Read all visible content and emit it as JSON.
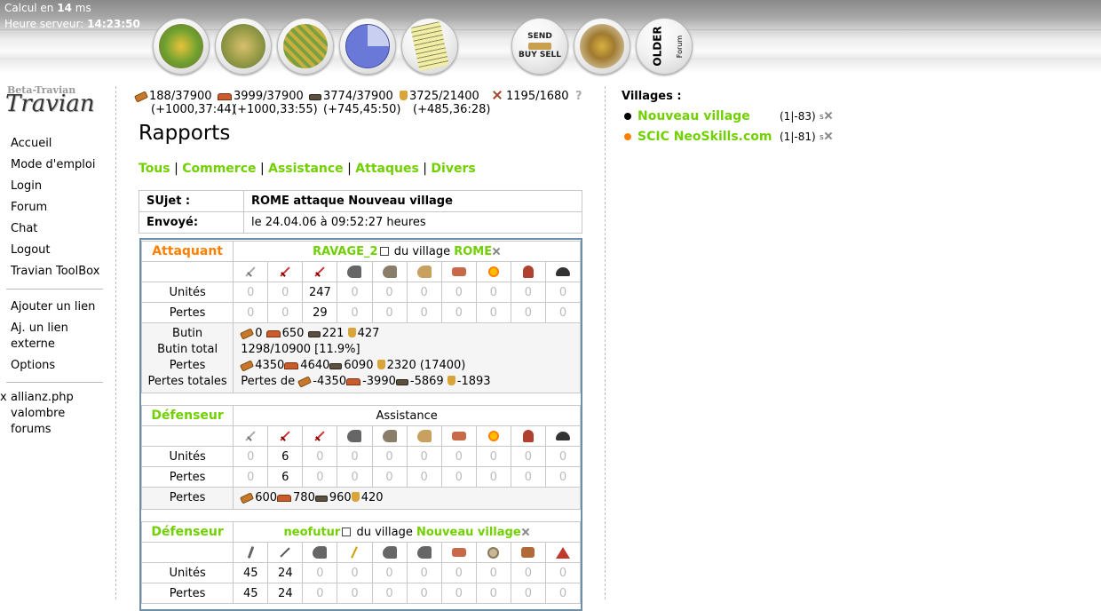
{
  "topbar": {
    "calc_prefix": "Calcul en ",
    "calc_value": "14",
    "calc_suffix": " ms",
    "heure_label": "Heure serveur: ",
    "heure_value": "14:23:50",
    "nav_buttons": [
      {
        "name": "village-overview",
        "icon": "village-fields-icon"
      },
      {
        "name": "village-center",
        "icon": "village-center-icon"
      },
      {
        "name": "map",
        "icon": "map-icon"
      },
      {
        "name": "statistics",
        "icon": "statistics-pie-icon"
      },
      {
        "name": "reports",
        "icon": "reports-icon"
      },
      {
        "name": "marketplace",
        "icon": "send-buy-sell-icon",
        "label_top": "SEND",
        "label_bottom": "BUY SELL"
      },
      {
        "name": "rally-point",
        "icon": "rally-point-icon"
      },
      {
        "name": "forum",
        "icon": "older-forum-icon",
        "label": "OLDER",
        "label2": "Forum"
      }
    ]
  },
  "logo": {
    "top": "Beta-Travian",
    "main": "Travian"
  },
  "menu": {
    "main": [
      "Accueil",
      "Mode d'emploi",
      "Login",
      "Forum",
      "Chat",
      "Logout",
      "Travian ToolBox"
    ],
    "links": [
      "Ajouter un lien",
      "Aj. un lien externe",
      "Options"
    ],
    "extra": [
      {
        "x": "x",
        "label": "allianz.php"
      },
      {
        "x": "x",
        "label": "valombre forums"
      }
    ]
  },
  "resources": {
    "wood": {
      "value": "188/37900",
      "prod": "(+1000,37:44)",
      "icon": "wood-icon"
    },
    "clay": {
      "value": "3999/37900",
      "prod": "(+1000,33:55)",
      "icon": "clay-icon"
    },
    "iron": {
      "value": "3774/37900",
      "prod": "(+745,45:50)",
      "icon": "iron-icon"
    },
    "crop": {
      "value": "3725/21400",
      "prod": "(+485,36:28)",
      "icon": "crop-icon"
    },
    "consumption": {
      "value": "1195/1680",
      "icon": "crop-consumption-icon"
    },
    "help": "?"
  },
  "page": {
    "title": "Rapports"
  },
  "filters": [
    "Tous",
    "Commerce",
    "Assistance",
    "Attaques",
    "Divers"
  ],
  "report": {
    "subject_label": "SUjet :",
    "subject_value": "ROME attaque Nouveau village",
    "sent_label": "Envoyé:",
    "sent_value": "le 24.04.06 à 09:52:27 heures"
  },
  "attacker": {
    "role": "Attaquant",
    "player": "RAVAGE_2",
    "mid": " du village ",
    "village": "ROME",
    "units_label": "Unités",
    "losses_label": "Pertes",
    "units": [
      "0",
      "0",
      "247",
      "0",
      "0",
      "0",
      "0",
      "0",
      "0",
      "0"
    ],
    "losses": [
      "0",
      "0",
      "29",
      "0",
      "0",
      "0",
      "0",
      "0",
      "0",
      "0"
    ],
    "butin_label": "Butin",
    "butin": [
      "0",
      "650",
      "221",
      "427"
    ],
    "butin_total_label": "Butin total",
    "butin_total": "1298/10900 [11.9%]",
    "pertes_label": "Pertes",
    "pertes": [
      "4350",
      "4640",
      "6090",
      "2320"
    ],
    "pertes_sum": " (17400)",
    "pertes_totales_label": "Pertes totales",
    "pertes_totales_prefix": "Pertes de ",
    "pertes_totales": [
      "-4350",
      "-3990",
      "-5869",
      "-1893"
    ]
  },
  "defender1": {
    "role": "Défenseur",
    "subtitle": "Assistance",
    "units_label": "Unités",
    "losses_label": "Pertes",
    "units": [
      "0",
      "6",
      "0",
      "0",
      "0",
      "0",
      "0",
      "0",
      "0",
      "0"
    ],
    "losses": [
      "0",
      "6",
      "0",
      "0",
      "0",
      "0",
      "0",
      "0",
      "0",
      "0"
    ],
    "pertes_label": "Pertes",
    "pertes": [
      "600",
      "780",
      "960",
      "420"
    ]
  },
  "defender2": {
    "role": "Défenseur",
    "player": "neofutur",
    "mid": " du village ",
    "village": "Nouveau village",
    "units_label": "Unités",
    "losses_label": "Pertes",
    "units": [
      "45",
      "24",
      "0",
      "0",
      "0",
      "0",
      "0",
      "0",
      "0",
      "0"
    ],
    "losses": [
      "45",
      "24",
      "0",
      "0",
      "0",
      "0",
      "0",
      "0",
      "0",
      "0"
    ]
  },
  "villages": {
    "title": "Villages :",
    "list": [
      {
        "name": "Nouveau village",
        "coords": "(1|-83)",
        "dot_color": "#000000"
      },
      {
        "name": "SCIC NeoSkills.com",
        "coords": "(1|-81)",
        "dot_color": "#ff8000"
      }
    ],
    "icon_text": "s"
  },
  "colors": {
    "link": "#71d000",
    "attacker": "#ff8000",
    "frame": "#6f8fa8"
  }
}
